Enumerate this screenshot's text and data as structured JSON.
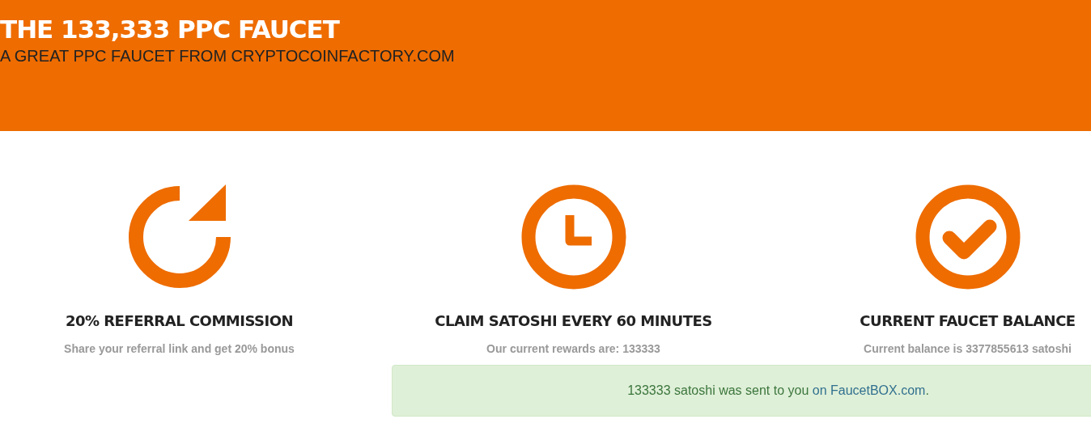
{
  "header": {
    "title": "THE 133,333 PPC FAUCET",
    "subtitle": "A GREAT PPC FAUCET FROM CRYPTOCOINFACTORY.COM"
  },
  "features": [
    {
      "kind": "refresh",
      "title": "20% REFERRAL COMMISSION",
      "text": "Share your referral link and get 20% bonus"
    },
    {
      "kind": "clock",
      "title": "CLAIM SATOSHI EVERY 60 MINUTES",
      "text": "Our current rewards are: 133333"
    },
    {
      "kind": "check",
      "title": "CURRENT FAUCET BALANCE",
      "text": "Current balance is 3377855613 satoshi"
    }
  ],
  "alert": {
    "text": "133333 satoshi was sent to you",
    "link": "on FaucetBOX.com",
    "after": "."
  }
}
